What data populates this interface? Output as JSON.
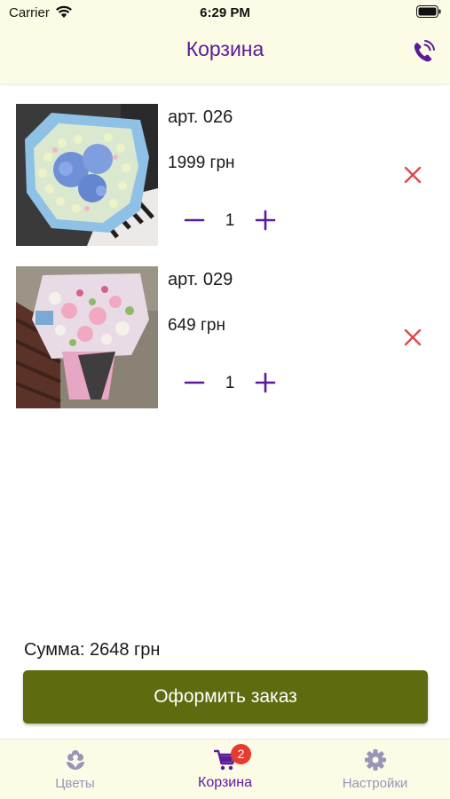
{
  "status_bar": {
    "carrier": "Carrier",
    "time": "6:29 PM"
  },
  "header": {
    "title": "Корзина",
    "call_icon": "phone-icon"
  },
  "cart": {
    "items": [
      {
        "sku": "арт. 026",
        "price": "1999 грн",
        "quantity": "1",
        "image": "blue-hydrangea-bouquet"
      },
      {
        "sku": "арт. 029",
        "price": "649 грн",
        "quantity": "1",
        "image": "pink-mixed-bouquet"
      }
    ]
  },
  "summary": {
    "total": "Сумма: 2648 грн"
  },
  "order_button": {
    "label": "Оформить заказ"
  },
  "tabbar": {
    "tabs": [
      {
        "label": "Цветы",
        "icon": "flower-icon",
        "active": false
      },
      {
        "label": "Корзина",
        "icon": "cart-icon",
        "active": true,
        "badge": "2"
      },
      {
        "label": "Настройки",
        "icon": "gear-icon",
        "active": false
      }
    ]
  },
  "colors": {
    "accent": "#5a1a9a",
    "order_button": "#606a0e",
    "remove": "#e04848",
    "bar_background": "#fcfbe6",
    "badge": "#e63c30"
  }
}
